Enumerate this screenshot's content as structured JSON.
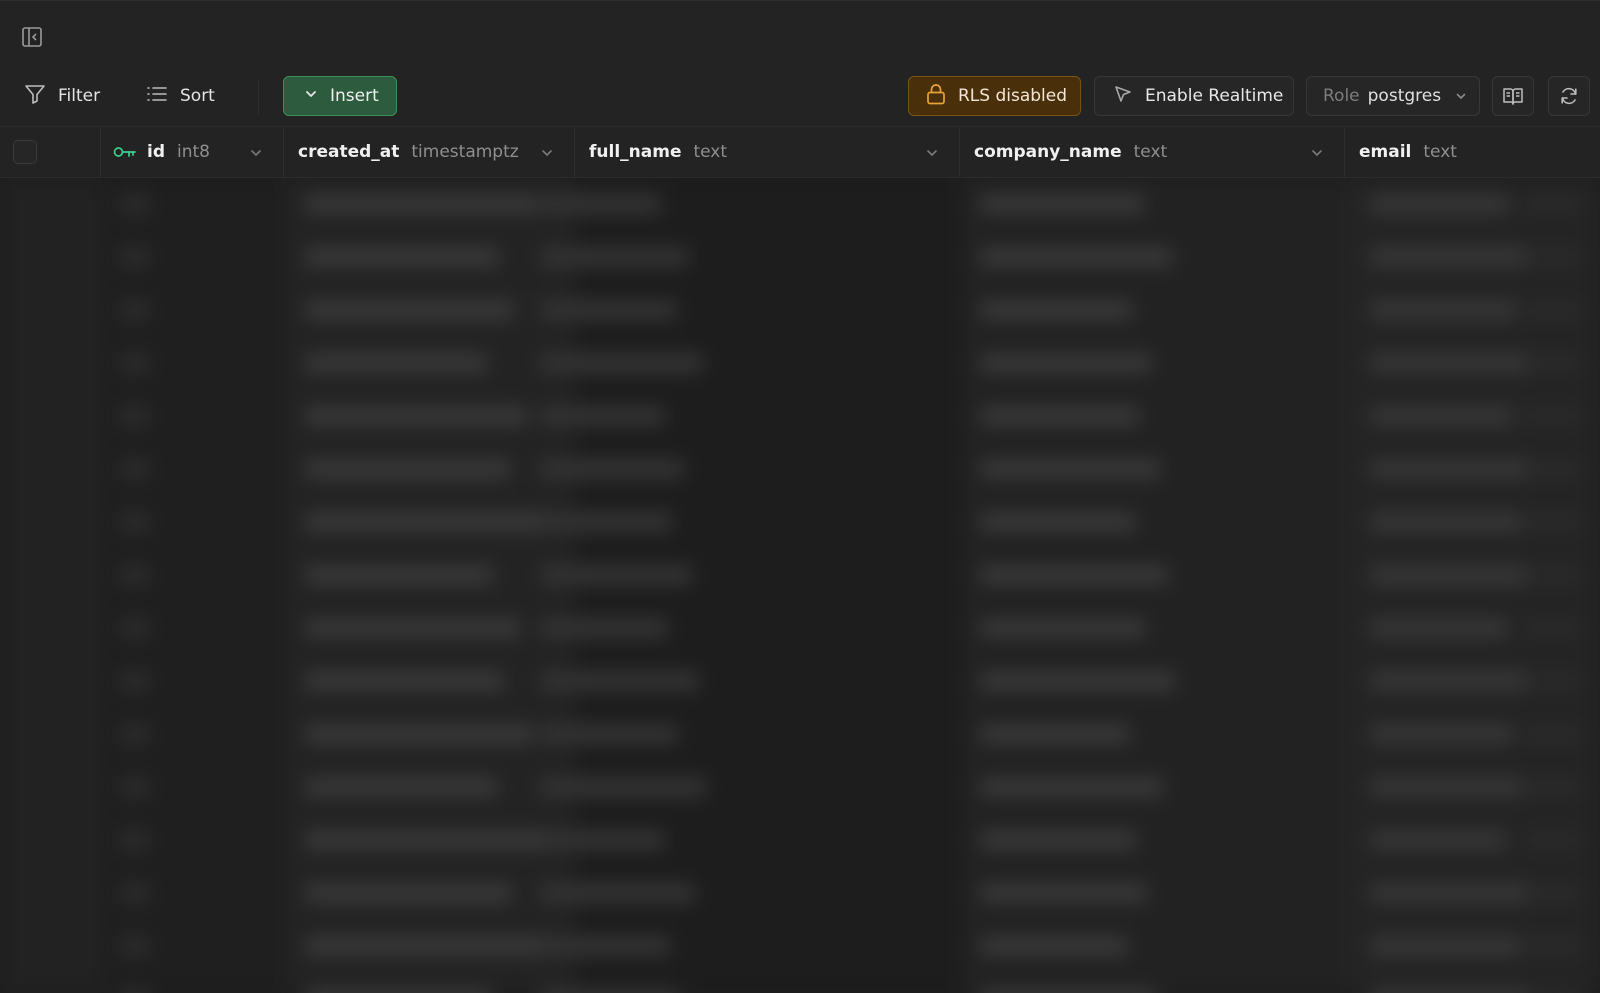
{
  "toolbar": {
    "filter_label": "Filter",
    "sort_label": "Sort",
    "insert_label": "Insert",
    "rls_label": "RLS disabled",
    "realtime_label": "Enable Realtime",
    "role_label": "Role",
    "role_value": "postgres"
  },
  "icons": {
    "sidebar_toggle": "sidebar-collapse-icon",
    "filter": "filter-icon",
    "sort": "list-icon",
    "insert": "chevron-down-icon",
    "rls": "lock-icon",
    "realtime": "cursor-icon",
    "role": "chevron-down-icon",
    "docs": "book-icon",
    "refresh": "refresh-icon",
    "primary_key": "key-icon"
  },
  "columns": [
    {
      "name": "id",
      "type": "int8",
      "primary_key": true
    },
    {
      "name": "created_at",
      "type": "timestamptz"
    },
    {
      "name": "full_name",
      "type": "text"
    },
    {
      "name": "company_name",
      "type": "text"
    },
    {
      "name": "email",
      "type": "text"
    }
  ],
  "colors": {
    "background": "#1c1c1c",
    "toolbar": "#232323",
    "insert_bg": "#2c5c3d",
    "insert_border": "#3e8e5a",
    "rls_bg": "#4a2f0b",
    "rls_border": "#7a5214",
    "key_green": "#3ecf8e",
    "rls_icon": "#e8a23a"
  }
}
